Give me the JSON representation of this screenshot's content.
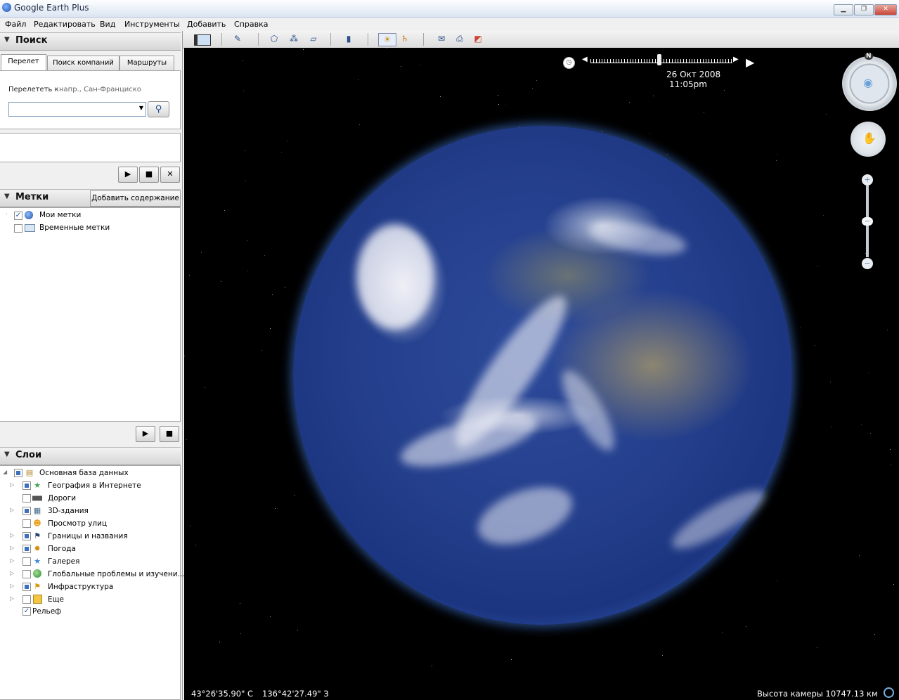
{
  "window": {
    "title": "Google Earth Plus",
    "buttons": [
      "▁",
      "❐",
      "✕"
    ]
  },
  "menu": [
    "Файл",
    "Редактировать",
    "Вид",
    "Инструменты",
    "Добавить",
    "Справка"
  ],
  "search": {
    "header": "Поиск",
    "tabs": [
      "Перелет",
      "Поиск компаний",
      "Маршруты"
    ],
    "fly_to_label": "Перелететь к",
    "fly_to_hint": "напр., Сан-Франциско",
    "input_value": ""
  },
  "places": {
    "header": "Метки",
    "add_content": "Добавить содержание",
    "items": [
      {
        "label": "Мои метки",
        "checked": true
      },
      {
        "label": "Временные метки",
        "checked": false
      }
    ]
  },
  "layers": {
    "header": "Слои",
    "root": "Основная база данных",
    "items": [
      {
        "label": "География в Интернете",
        "state": "partial"
      },
      {
        "label": "Дороги",
        "state": "unchecked"
      },
      {
        "label": "3D-здания",
        "state": "partial"
      },
      {
        "label": "Просмотр улиц",
        "state": "unchecked"
      },
      {
        "label": "Границы и названия",
        "state": "partial"
      },
      {
        "label": "Погода",
        "state": "partial"
      },
      {
        "label": "Галерея",
        "state": "unchecked"
      },
      {
        "label": "Глобальные проблемы и изучени...",
        "state": "unchecked"
      },
      {
        "label": "Инфраструктура",
        "state": "partial"
      },
      {
        "label": "Еще",
        "state": "unchecked"
      }
    ],
    "relief": {
      "label": "Рельеф",
      "checked": true
    }
  },
  "time": {
    "date": "26 Окт 2008",
    "time": "11:05pm"
  },
  "compass": {
    "north": "N"
  },
  "status": {
    "lat": "43°26'35.90\"  С",
    "lon": "136°42'27.49\"  З",
    "altitude": "Высота камеры 10747.13 км"
  }
}
